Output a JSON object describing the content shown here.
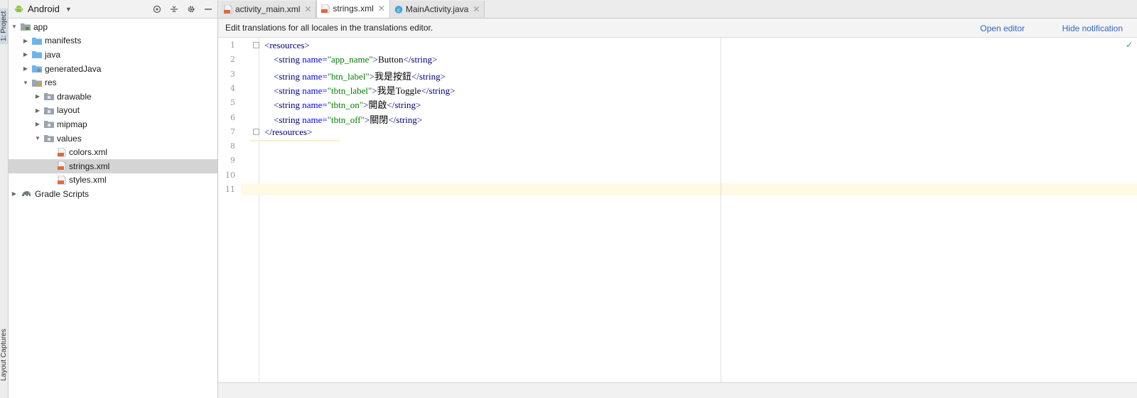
{
  "tool_strip": {
    "project_label": "1: Project",
    "captures_label": "Layout Captures"
  },
  "project_panel": {
    "view_selector": "Android",
    "icons": [
      "locate-icon",
      "collapse-icon",
      "settings-icon",
      "hide-icon"
    ],
    "tree": [
      {
        "label": "app",
        "level": 0,
        "expanded": true,
        "type": "module"
      },
      {
        "label": "manifests",
        "level": 1,
        "expanded": false,
        "type": "folder"
      },
      {
        "label": "java",
        "level": 1,
        "expanded": false,
        "type": "folder"
      },
      {
        "label": "generatedJava",
        "level": 1,
        "expanded": false,
        "type": "folder-gen"
      },
      {
        "label": "res",
        "level": 1,
        "expanded": true,
        "type": "res"
      },
      {
        "label": "drawable",
        "level": 2,
        "expanded": false,
        "type": "folder-gray"
      },
      {
        "label": "layout",
        "level": 2,
        "expanded": false,
        "type": "folder-gray"
      },
      {
        "label": "mipmap",
        "level": 2,
        "expanded": false,
        "type": "folder-gray"
      },
      {
        "label": "values",
        "level": 2,
        "expanded": true,
        "type": "folder-gray"
      },
      {
        "label": "colors.xml",
        "level": 3,
        "type": "xml"
      },
      {
        "label": "strings.xml",
        "level": 3,
        "type": "xml",
        "selected": true
      },
      {
        "label": "styles.xml",
        "level": 3,
        "type": "xml"
      },
      {
        "label": "Gradle Scripts",
        "level": 0,
        "expanded": false,
        "type": "gradle"
      }
    ]
  },
  "tabs": [
    {
      "label": "activity_main.xml",
      "icon": "xml-file-icon",
      "active": false
    },
    {
      "label": "strings.xml",
      "icon": "xml-file-icon",
      "active": true
    },
    {
      "label": "MainActivity.java",
      "icon": "java-class-icon",
      "active": false
    }
  ],
  "notification": {
    "text": "Edit translations for all locales in the translations editor.",
    "open_editor": "Open editor",
    "hide_notification": "Hide notification"
  },
  "editor": {
    "line_numbers": [
      "1",
      "2",
      "3",
      "4",
      "5",
      "6",
      "7",
      "8",
      "9",
      "10",
      "11"
    ],
    "lines": [
      {
        "indent": "",
        "parts": [
          {
            "k": "tag",
            "t": "<resources>"
          }
        ]
      },
      {
        "indent": "    ",
        "parts": [
          {
            "k": "tag",
            "t": "<string "
          },
          {
            "k": "attr",
            "t": "name="
          },
          {
            "k": "val",
            "t": "\"app_name\""
          },
          {
            "k": "tag",
            "t": ">"
          },
          {
            "k": "text",
            "t": "Button"
          },
          {
            "k": "tag",
            "t": "</string>"
          }
        ]
      },
      {
        "indent": "    ",
        "parts": [
          {
            "k": "tag",
            "t": "<string "
          },
          {
            "k": "attr",
            "t": "name="
          },
          {
            "k": "val",
            "t": "\"btn_label\""
          },
          {
            "k": "tag",
            "t": ">"
          },
          {
            "k": "text",
            "t": "我是按鈕"
          },
          {
            "k": "tag",
            "t": "</string>"
          }
        ]
      },
      {
        "indent": "    ",
        "parts": [
          {
            "k": "tag",
            "t": "<string "
          },
          {
            "k": "attr",
            "t": "name="
          },
          {
            "k": "val",
            "t": "\"tbtn_label\""
          },
          {
            "k": "tag",
            "t": ">"
          },
          {
            "k": "text",
            "t": "我是Toggle"
          },
          {
            "k": "tag",
            "t": "</string>"
          }
        ]
      },
      {
        "indent": "    ",
        "parts": [
          {
            "k": "tag",
            "t": "<string "
          },
          {
            "k": "attr",
            "t": "name="
          },
          {
            "k": "val",
            "t": "\"tbtn_on\""
          },
          {
            "k": "tag",
            "t": ">"
          },
          {
            "k": "text",
            "t": "開啟"
          },
          {
            "k": "tag",
            "t": "</string>"
          }
        ]
      },
      {
        "indent": "    ",
        "parts": [
          {
            "k": "tag",
            "t": "<string "
          },
          {
            "k": "attr",
            "t": "name="
          },
          {
            "k": "val",
            "t": "\"tbtn_off\""
          },
          {
            "k": "tag",
            "t": ">"
          },
          {
            "k": "text",
            "t": "關閉"
          },
          {
            "k": "tag",
            "t": "</string>"
          }
        ]
      },
      {
        "indent": "",
        "parts": [
          {
            "k": "tag",
            "t": "</resources>"
          }
        ]
      },
      {
        "indent": "",
        "parts": []
      },
      {
        "indent": "",
        "parts": []
      },
      {
        "indent": "",
        "parts": []
      },
      {
        "indent": "",
        "parts": []
      }
    ],
    "current_line": "11",
    "inspection_status": "no-problems-check-icon"
  },
  "colors": {
    "tag": "#000080",
    "attr": "#0000ff",
    "value": "#008000",
    "link": "#2f65ca",
    "caret_line": "#fffae3"
  }
}
